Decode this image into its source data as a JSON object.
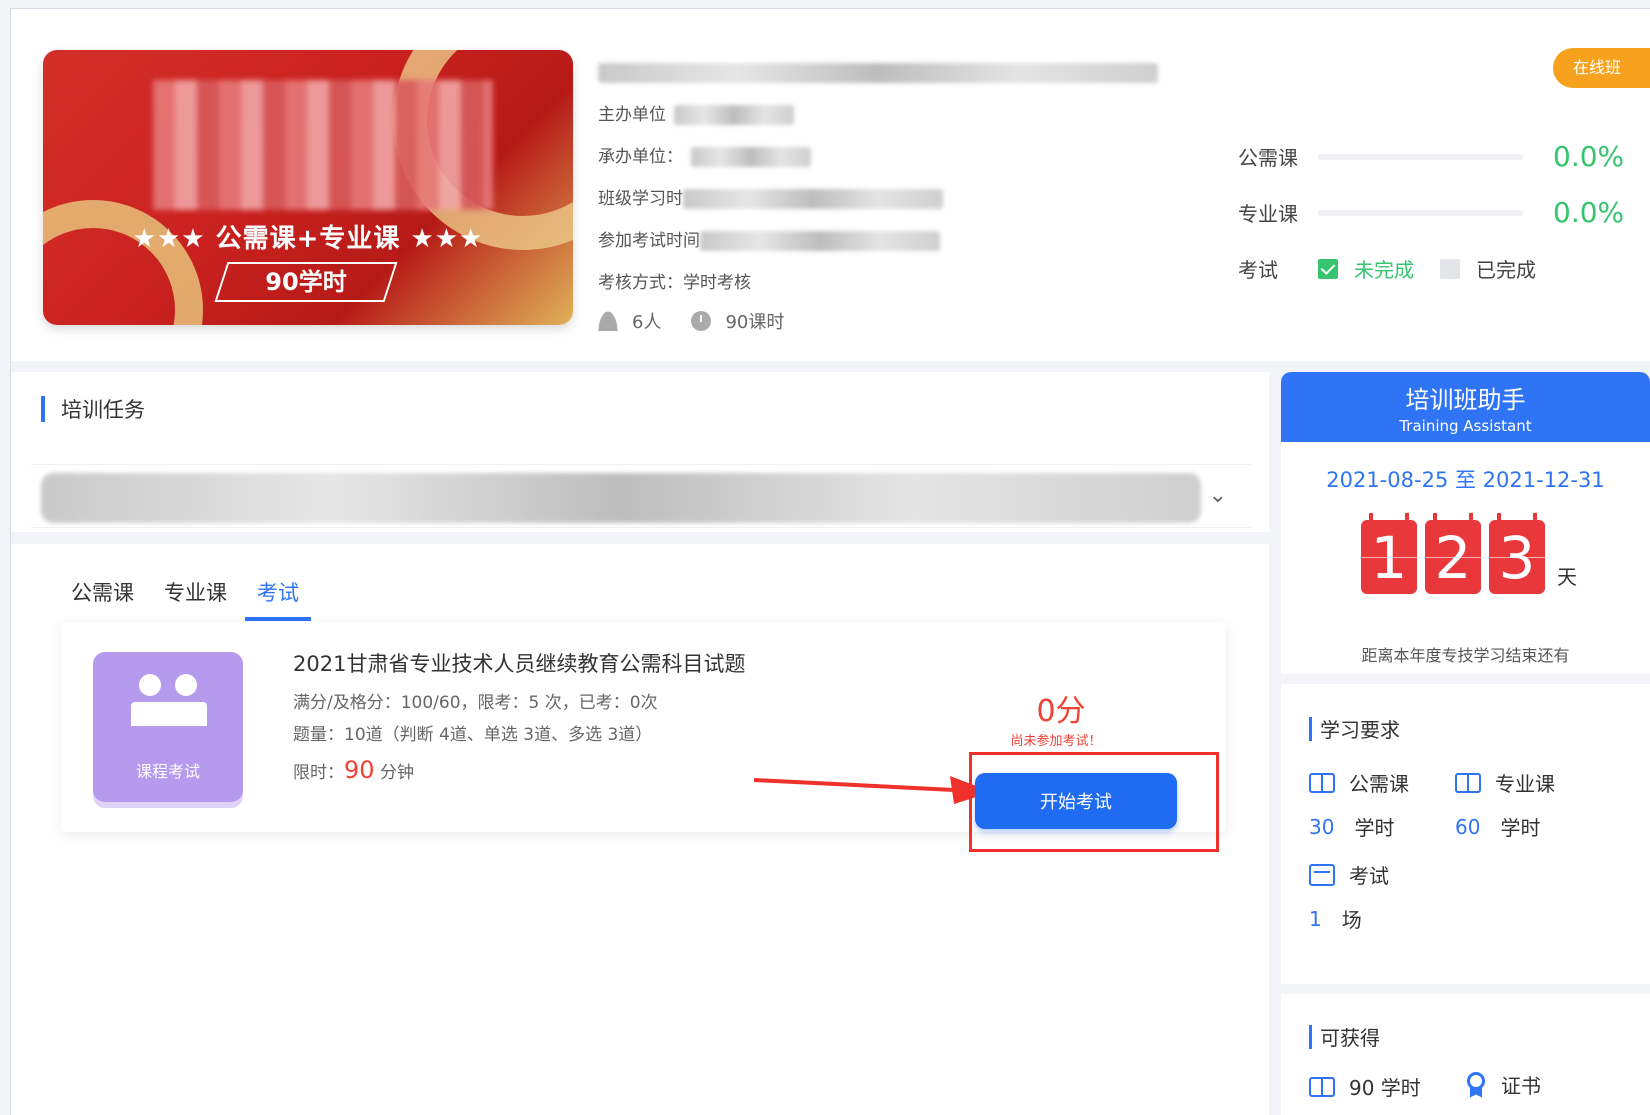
{
  "course": {
    "cover_title": "★★★ 公需课+专业课 ★★★",
    "cover_hours": "90学时",
    "info_labels": [
      "主办单位",
      "承办单位：",
      "班级学习时",
      "参加考试时间",
      "考核方式：学时考核"
    ],
    "students": "6人",
    "hours": "90课时",
    "online_badge": "在线班"
  },
  "progress": {
    "public_label": "公需课",
    "public_pct": "0.0%",
    "pro_label": "专业课",
    "pro_pct": "0.0%",
    "exam_label": "考试",
    "incomplete": "未完成",
    "complete": "已完成"
  },
  "main": {
    "section_title": "培训任务",
    "tabs": [
      "公需课",
      "专业课",
      "考试"
    ],
    "active_tab": "考试"
  },
  "exam": {
    "icon_label": "课程考试",
    "title": "2021甘肃省专业技术人员继续教育公需科目试题",
    "scores_line": "满分/及格分：100/60，限考：5 次，已考：0次",
    "count_line": "题量：10道（判断 4道、单选 3道、多选 3道）",
    "time_prefix": "限时：",
    "time_value": "90",
    "time_unit": "分钟",
    "score": "0分",
    "not_joined": "尚未参加考试！",
    "start_button": "开始考试"
  },
  "assistant": {
    "title": "培训班助手",
    "subtitle": "Training Assistant",
    "date_range": "2021-08-25 至 2021-12-31",
    "days_digits": [
      "1",
      "2",
      "3"
    ],
    "days_unit": "天",
    "remain_text": "距离本年度专技学习结束还有"
  },
  "requirements": {
    "title": "学习要求",
    "public_label": "公需课",
    "public_hours": "30",
    "pro_label": "专业课",
    "pro_hours": "60",
    "hour_unit": "学时",
    "exam_label": "考试",
    "exam_count": "1",
    "exam_unit": "场"
  },
  "gain": {
    "title": "可获得",
    "hours": "90 学时",
    "certificate": "证书"
  },
  "colors": {
    "primary": "#2f74f5",
    "success": "#36c46f",
    "danger": "#f04134",
    "badge": "#f6a21e"
  }
}
